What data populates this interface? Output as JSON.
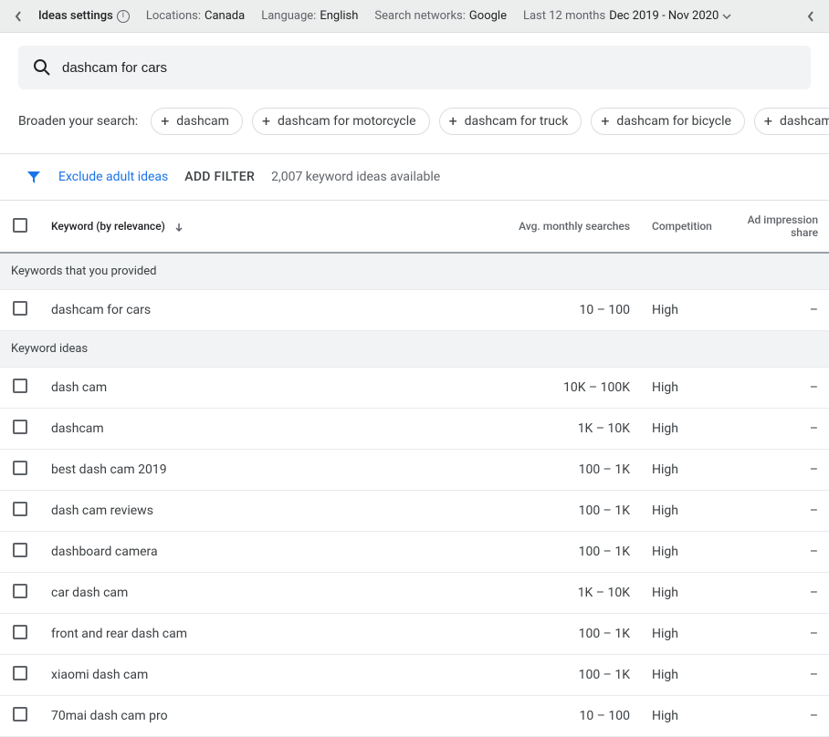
{
  "topbar": {
    "settings_label": "Ideas settings",
    "locations_label": "Locations:",
    "locations_value": "Canada",
    "language_label": "Language:",
    "language_value": "English",
    "networks_label": "Search networks:",
    "networks_value": "Google",
    "period_label": "Last 12 months",
    "period_value": "Dec 2019 - Nov 2020"
  },
  "search": {
    "value": "dashcam for cars"
  },
  "broaden": {
    "label": "Broaden your search:",
    "chips": [
      "dashcam",
      "dashcam for motorcycle",
      "dashcam for truck",
      "dashcam for bicycle",
      "dashcam for van"
    ]
  },
  "filters": {
    "exclude_adult": "Exclude adult ideas",
    "add_filter": "ADD FILTER",
    "available": "2,007 keyword ideas available"
  },
  "table": {
    "headers": {
      "keyword": "Keyword (by relevance)",
      "searches": "Avg. monthly searches",
      "competition": "Competition",
      "impression": "Ad impression share"
    },
    "sections": [
      {
        "title": "Keywords that you provided",
        "rows": [
          {
            "keyword": "dashcam for cars",
            "searches": "10 – 100",
            "competition": "High",
            "impression": "–"
          }
        ]
      },
      {
        "title": "Keyword ideas",
        "rows": [
          {
            "keyword": "dash cam",
            "searches": "10K – 100K",
            "competition": "High",
            "impression": "–"
          },
          {
            "keyword": "dashcam",
            "searches": "1K – 10K",
            "competition": "High",
            "impression": "–"
          },
          {
            "keyword": "best dash cam 2019",
            "searches": "100 – 1K",
            "competition": "High",
            "impression": "–"
          },
          {
            "keyword": "dash cam reviews",
            "searches": "100 – 1K",
            "competition": "High",
            "impression": "–"
          },
          {
            "keyword": "dashboard camera",
            "searches": "100 – 1K",
            "competition": "High",
            "impression": "–"
          },
          {
            "keyword": "car dash cam",
            "searches": "1K – 10K",
            "competition": "High",
            "impression": "–"
          },
          {
            "keyword": "front and rear dash cam",
            "searches": "100 – 1K",
            "competition": "High",
            "impression": "–"
          },
          {
            "keyword": "xiaomi dash cam",
            "searches": "100 – 1K",
            "competition": "High",
            "impression": "–"
          },
          {
            "keyword": "70mai dash cam pro",
            "searches": "10 – 100",
            "competition": "High",
            "impression": "–"
          }
        ]
      }
    ]
  }
}
